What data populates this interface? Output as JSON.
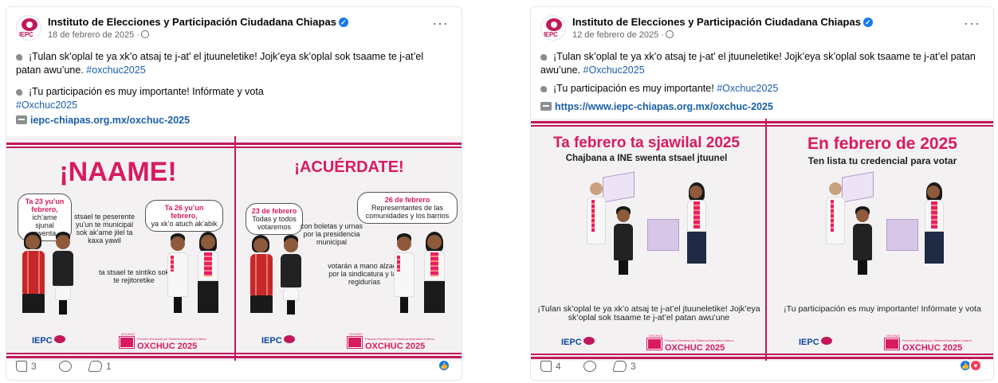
{
  "posts": [
    {
      "page_name": "Instituto de Elecciones y Participación Ciudadana Chiapas",
      "date": "18 de febrero de 2025 ·",
      "para1": "¡Tulan sk’oplal te ya xk’o atsaj te j-at’ el jtuuneletike! Jojk’eya sk’oplal sok tsaame te j-at’el patan awu’une.",
      "para1_tag": "#oxchuc2025",
      "para2": "¡Tu participación es muy importante! Infórmate y vota",
      "para2_tag": "#Oxchuc2025",
      "link": "iepc-chiapas.org.mx/oxchuc-2025",
      "image": {
        "left_title": "¡NAAME!",
        "right_title": "¡ACUÉRDATE!",
        "b1_title": "Ta 23 yu’un febrero,",
        "b1_text": "ich’ame sjunal swenta",
        "b2_text": "stsael te peserente yu’un te municipal sok ak’ame jilel ta kaxa yawil",
        "b3_title": "Ta 26 yu’un febrero,",
        "b3_text": "ya xk’o atuch ak’abik",
        "b4_text": "ta stsael te sintiko sok te rejitoretike",
        "b5_title": "23 de febrero",
        "b5_text": "Todas y todos votaremos",
        "b6_text": "con boletas y urnas por la presidencia municipal",
        "b7_title": "26 de febrero",
        "b7_text": "Representantes de las comunidades y los barrios",
        "b8_text": "votarán a mano alzada por la sindicatura y las regidurías",
        "iepc": "IEPC",
        "oxchuc": "OXCHUC 2025",
        "oxchuc_top": "OXCHUC",
        "oxchuc_small": "Proceso Electoral por Sistema Normativo Interno"
      },
      "likes": "3",
      "shares": "1",
      "reaction_color": "#1877f2"
    },
    {
      "page_name": "Instituto de Elecciones y Participación Ciudadana Chiapas",
      "date": "12 de febrero de 2025 ·",
      "para1": "¡Tulan sk’oplal te ya xk’o atsaj te j-at’ el jtuuneletike! Jojk’eya sk’oplal sok tsaame te j-at’el patan awu’une.",
      "para1_tag": "#Oxchuc2025",
      "para2": "¡Tu participación es muy importante!",
      "para2_tag": "#Oxchuc2025",
      "link": "https://www.iepc-chiapas.org.mx/oxchuc-2025",
      "image": {
        "left_title": "Ta febrero ta sjawilal 2025",
        "left_sub": "Chajbana a INE swenta stsael jtuunel",
        "right_title": "En febrero de 2025",
        "right_sub": "Ten lista tu credencial para votar",
        "left_caption": "¡Tulan sk’oplal te ya xk’o atsaj te j-at’el jtuuneletike! Jojk’eya sk’oplal sok tsaame te j-at’el patan awu’une",
        "right_caption": "¡Tu participación es muy importante! Infórmate y vota",
        "iepc": "IEPC",
        "oxchuc": "OXCHUC 2025",
        "oxchuc_top": "OXCHUC",
        "oxchuc_small": "Proceso Electoral por Sistema Normativo Interno"
      },
      "likes": "4",
      "shares": "3",
      "reaction_colors": [
        "#1877f2",
        "#f33e58"
      ]
    }
  ]
}
